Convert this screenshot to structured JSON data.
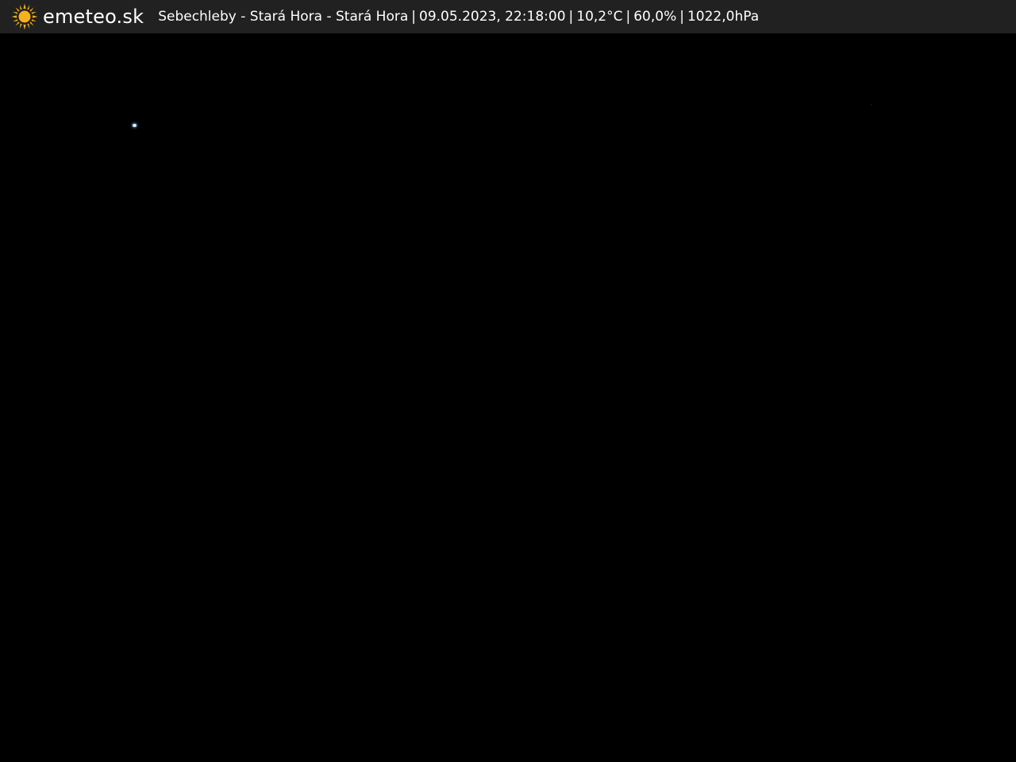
{
  "brand": {
    "name": "emeteo.sk",
    "icon": "sun-icon",
    "icon_color": "#f5b21e"
  },
  "caption": {
    "location": "Sebechleby - Stará Hora - Stará Hora",
    "datetime": "09.05.2023, 22:18:00",
    "temperature": "10,2°C",
    "humidity": "60,0%",
    "pressure": "1022,0hPa",
    "separator": "|"
  },
  "colors": {
    "bar_background": "#212121",
    "text": "#ffffff",
    "image_background": "#000000"
  }
}
